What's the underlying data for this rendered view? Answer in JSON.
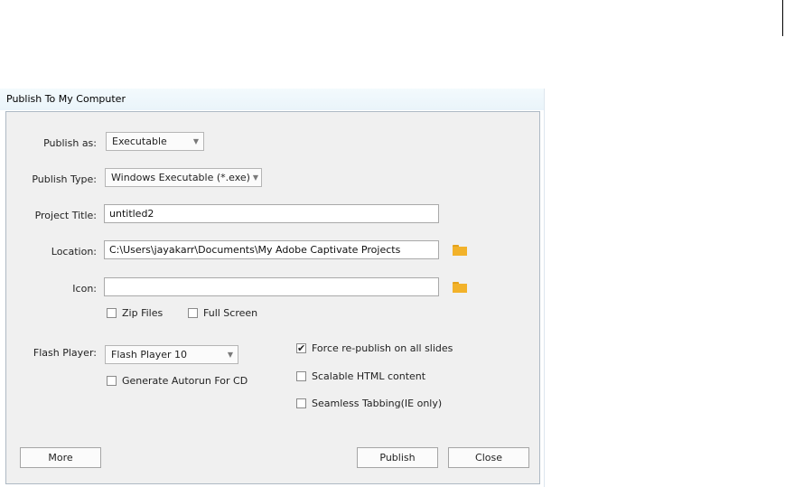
{
  "dialog": {
    "title": "Publish To My Computer",
    "publish_as": {
      "label": "Publish as:",
      "value": "Executable"
    },
    "publish_type": {
      "label": "Publish Type:",
      "value": "Windows Executable (*.exe)"
    },
    "project_title": {
      "label": "Project Title:",
      "value": "untitled2"
    },
    "location": {
      "label": "Location:",
      "value": "C:\\Users\\jayakarr\\Documents\\My Adobe Captivate Projects"
    },
    "icon_field": {
      "label": "Icon:",
      "value": ""
    },
    "zip_files": {
      "label": "Zip Files",
      "checked": false
    },
    "full_screen": {
      "label": "Full Screen",
      "checked": false
    },
    "flash_player": {
      "label": "Flash Player:",
      "value": "Flash Player 10"
    },
    "generate_autorun": {
      "label": "Generate Autorun For CD",
      "checked": false
    },
    "force_republish": {
      "label": "Force re-publish on all slides",
      "checked": true
    },
    "scalable_html": {
      "label": "Scalable HTML content",
      "checked": false
    },
    "seamless_tabbing": {
      "label": "Seamless Tabbing(IE only)",
      "checked": false
    },
    "buttons": {
      "more": "More",
      "publish": "Publish",
      "close": "Close"
    }
  },
  "icons": {
    "dropdown": "chevron-down-icon",
    "browse": "folder-icon",
    "check": "checkmark-icon"
  },
  "colors": {
    "folder": "#f2b22a",
    "panel": "#f0f0f0",
    "titlebar": "#eaf4fa"
  }
}
